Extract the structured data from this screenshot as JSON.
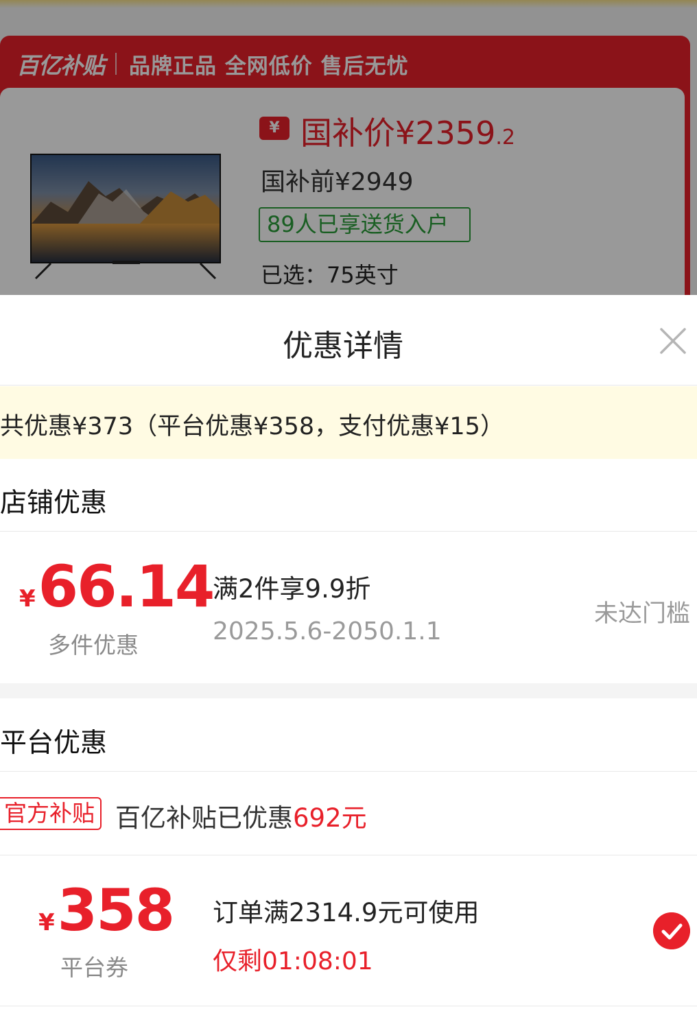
{
  "background": {
    "brand_logo": "百亿补贴",
    "brand_slogan": "品牌正品 全网低价 售后无忧",
    "coupon_icon": "¥",
    "price_main": "国补价¥2359",
    "price_decimal": ".2",
    "original_price": "国补前¥2949",
    "delivery_tag": "89人已享送货入户",
    "selected": "已选：75英寸"
  },
  "sheet": {
    "title": "优惠详情",
    "summary": "共优惠¥373（平台优惠¥358，支付优惠¥15）",
    "store_section": {
      "label": "店铺优惠",
      "item": {
        "currency": "¥",
        "amount": "66.14",
        "amount_label": "多件优惠",
        "condition": "满2件享9.9折",
        "validity": "2025.5.6-2050.1.1",
        "status": "未达门槛"
      }
    },
    "platform_section": {
      "label": "平台优惠",
      "official_badge": "官方补贴",
      "official_text": "百亿补贴已优惠",
      "official_amount": "692元",
      "coupon": {
        "currency": "¥",
        "amount": "358",
        "amount_label": "平台券",
        "condition": "订单满2314.9元可使用",
        "countdown": "仅剩01:08:01",
        "selected": true
      }
    }
  },
  "colors": {
    "accent_red": "#e8202a",
    "summary_bg": "#fffbe3",
    "tag_green": "#2a9d3a"
  },
  "icons": {
    "close": "close-icon",
    "check": "check-icon",
    "coupon": "coupon-icon"
  }
}
